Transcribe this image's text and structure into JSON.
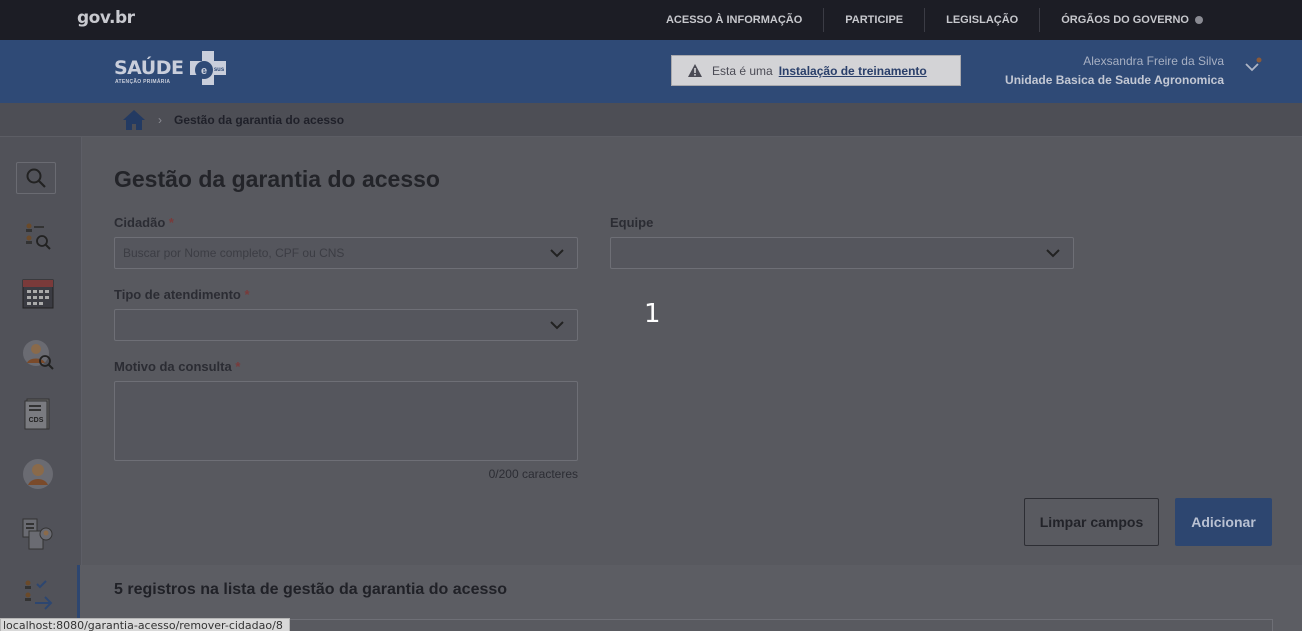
{
  "govbar": {
    "logo": "gov.br",
    "links": [
      "ACESSO À INFORMAÇÃO",
      "PARTICIPE",
      "LEGISLAÇÃO",
      "ÓRGÃOS DO GOVERNO"
    ]
  },
  "header": {
    "brand_word": "SAÚDE",
    "brand_sub": "ATENÇÃO PRIMÁRIA",
    "brand_badge": "e sus",
    "training_prefix": "Esta é uma",
    "training_link": "Instalação de treinamento",
    "user_name": "Alexsandra Freire da Silva",
    "user_unit": "Unidade Basica de Saude Agronomica"
  },
  "breadcrumb": {
    "separator": "›",
    "current": "Gestão da garantia do acesso"
  },
  "sidebar": {
    "icons": [
      "search-icon",
      "list-search-icon",
      "calendar-icon",
      "person-search-icon",
      "cds-form-icon",
      "citizen-icon",
      "forms-person-icon",
      "access-list-icon"
    ]
  },
  "form": {
    "title": "Gestão da garantia do acesso",
    "cidadao_label": "Cidadão",
    "cidadao_placeholder": "Buscar por Nome completo, CPF ou CNS",
    "equipe_label": "Equipe",
    "tipo_label": "Tipo de atendimento",
    "motivo_label": "Motivo da consulta",
    "required_mark": "*",
    "counter": "0/200 caracteres",
    "clear_button": "Limpar campos",
    "add_button": "Adicionar"
  },
  "overlay": {
    "number": "1"
  },
  "list": {
    "title": "5 registros na lista de gestão da garantia do acesso"
  },
  "status_url": "localhost:8080/garantia-acesso/remover-cidadao/8"
}
